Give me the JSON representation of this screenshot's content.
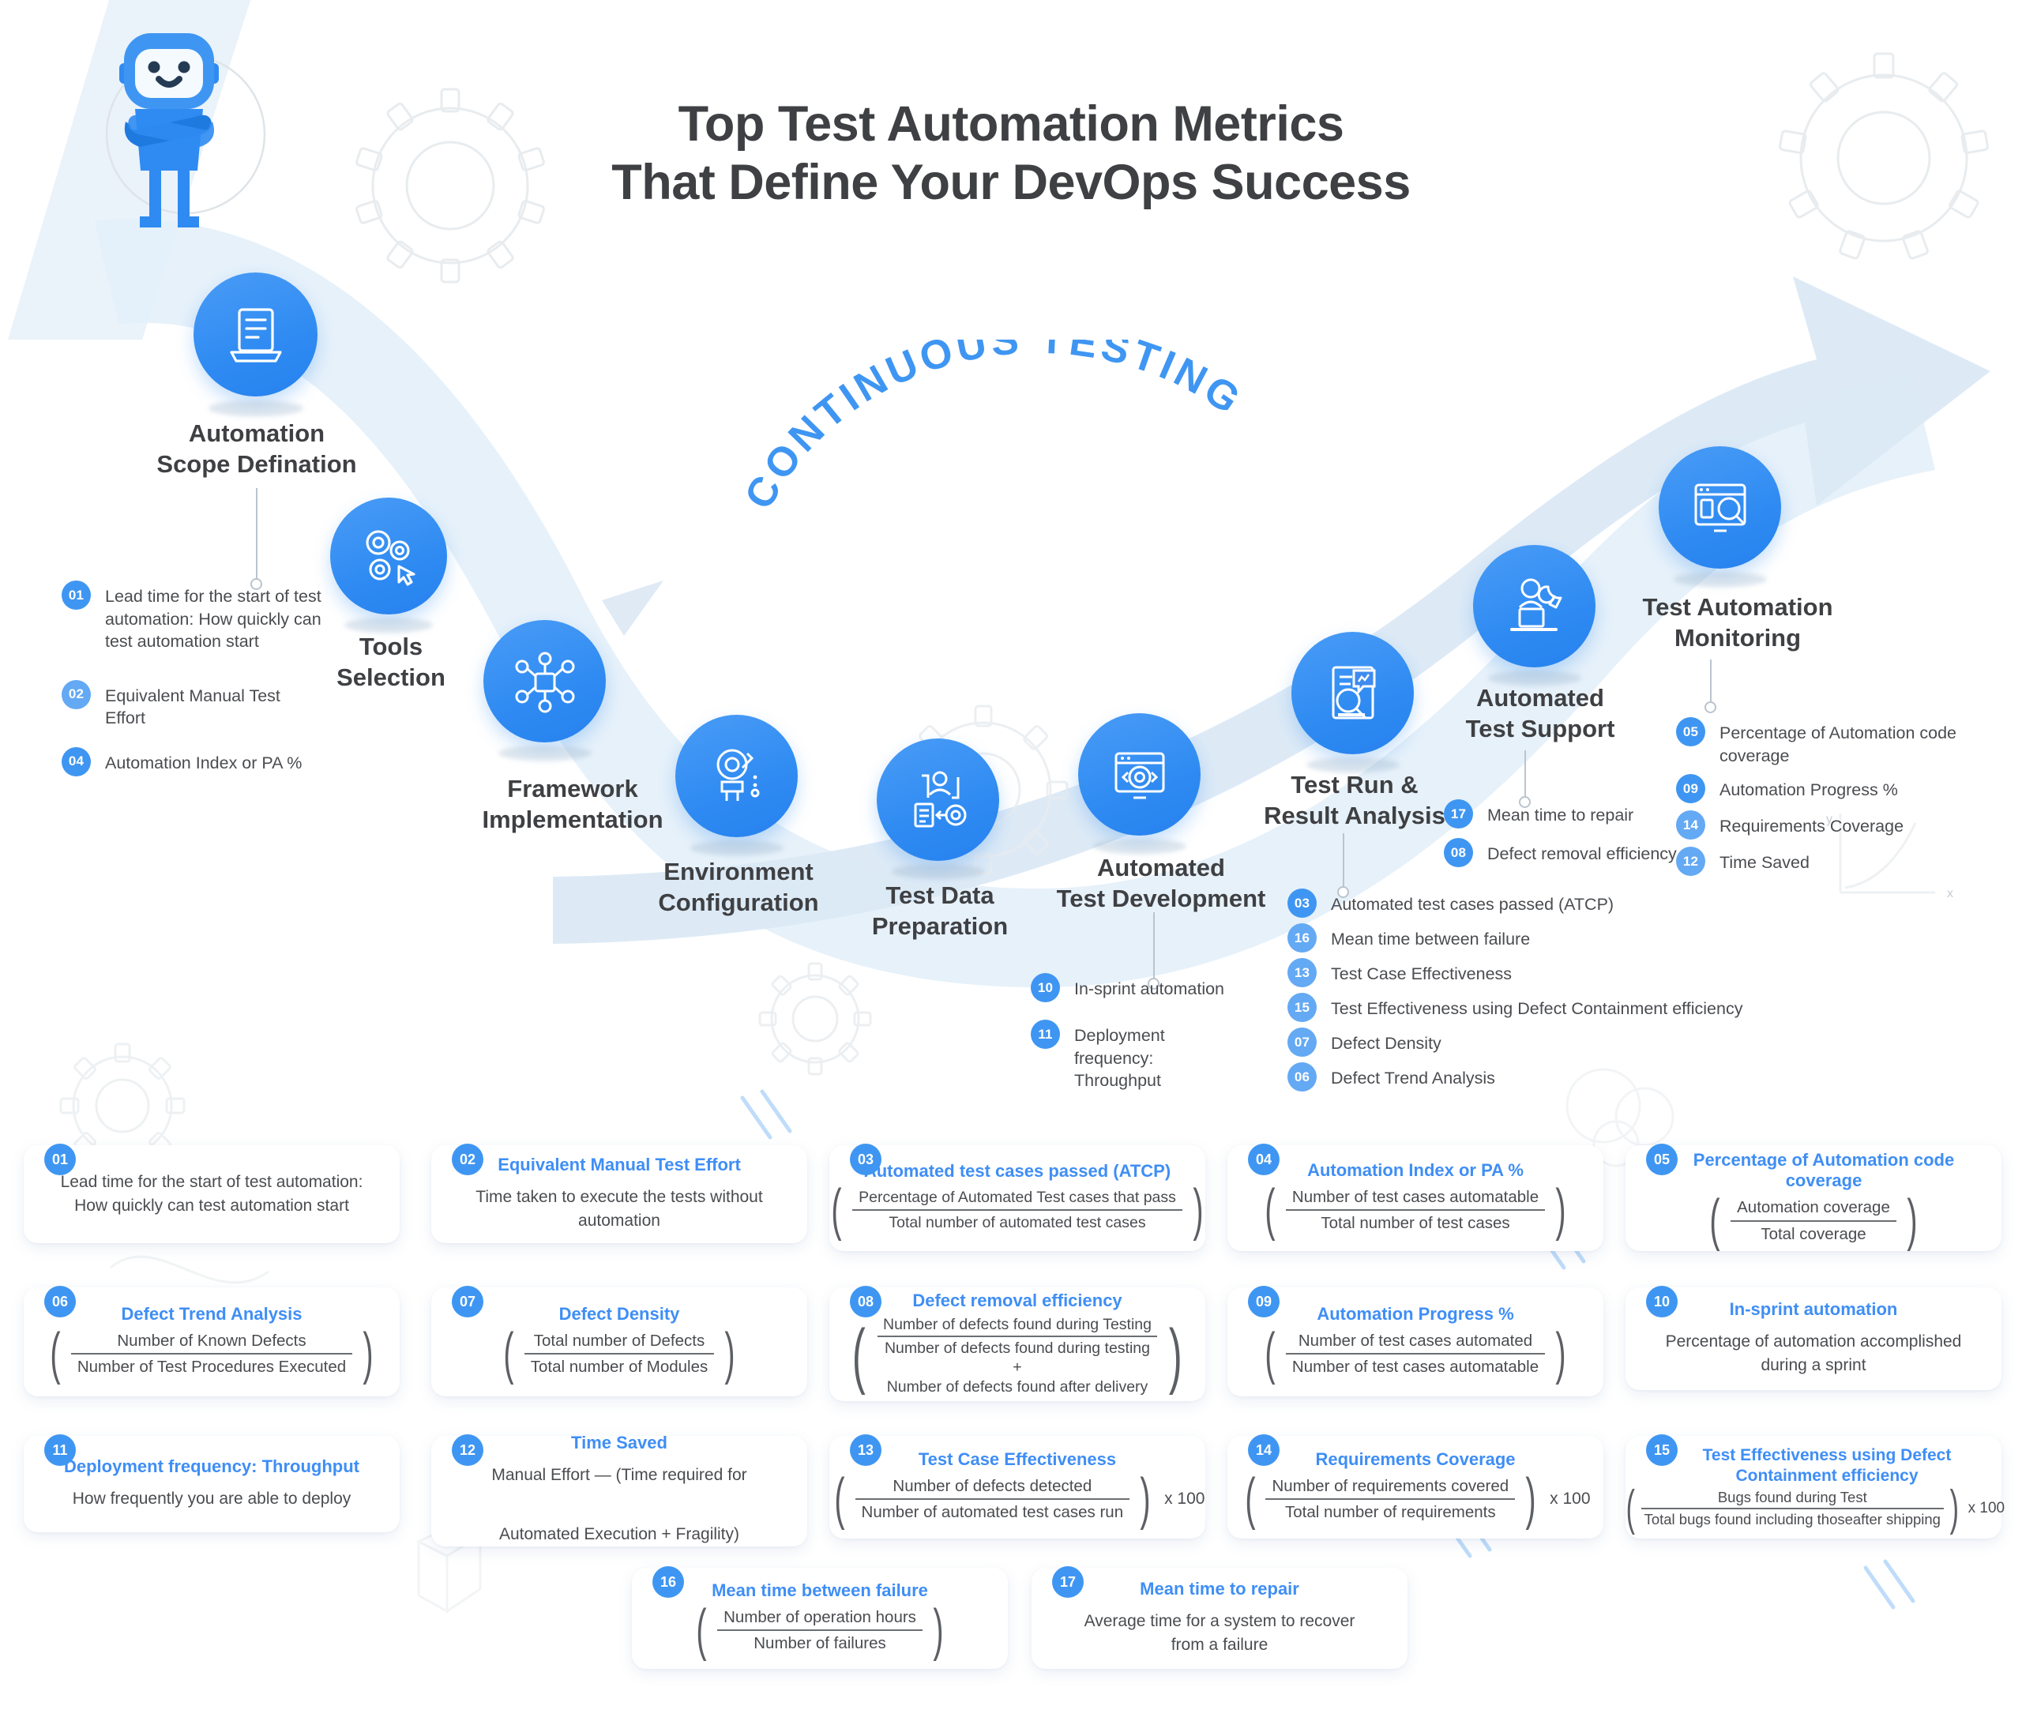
{
  "title": {
    "line1": "Top Test Automation Metrics",
    "line2": "That Define Your DevOps Success"
  },
  "arc_label": "CONTINUOUS TESTING",
  "colors": {
    "accent": "#3f96f2",
    "accent_text": "#3f8ef5",
    "title_text": "#3f4043",
    "body_text": "#4a4c50",
    "background": "#ffffff",
    "ribbon": "#dfecf9"
  },
  "mascot": {
    "name": "robot-mascot"
  },
  "nodes": [
    {
      "id": "automation-scope-defination",
      "label_line1": "Automation",
      "label_line2": "Scope Defination",
      "icon": "document-checklist-icon"
    },
    {
      "id": "tools-selection",
      "label_line1": "Tools",
      "label_line2": "Selection",
      "icon": "gears-cursor-icon"
    },
    {
      "id": "framework-implementation",
      "label_line1": "Framework",
      "label_line2": "Implementation",
      "icon": "network-nodes-icon"
    },
    {
      "id": "environment-configuration",
      "label_line1": "Environment",
      "label_line2": "Configuration",
      "icon": "wrench-gear-icon"
    },
    {
      "id": "test-data-preparation",
      "label_line1": "Test Data",
      "label_line2": "Preparation",
      "icon": "user-data-gear-icon"
    },
    {
      "id": "automated-test-development",
      "label_line1": "Automated",
      "label_line2": "Test Development",
      "icon": "code-gear-browser-icon"
    },
    {
      "id": "test-run-result-analysis",
      "label_line1": "Test Run &",
      "label_line2": "Result Analysis",
      "icon": "report-chart-search-icon"
    },
    {
      "id": "automated-test-support",
      "label_line1": "Automated",
      "label_line2": "Test Support",
      "icon": "support-engineer-icon"
    },
    {
      "id": "test-automation-monitoring",
      "label_line1": "Test Automation",
      "label_line2": "Monitoring",
      "icon": "dashboard-magnifier-icon"
    }
  ],
  "metric_groups": {
    "scope": [
      {
        "num": "01",
        "text": "Lead time for the start of test automation: How quickly can test automation start"
      },
      {
        "num": "02",
        "text": "Equivalent Manual Test Effort"
      },
      {
        "num": "04",
        "text": "Automation Index or PA %"
      }
    ],
    "test_development": [
      {
        "num": "10",
        "text": "In-sprint automation"
      },
      {
        "num": "11",
        "text": "Deployment frequency: Throughput"
      }
    ],
    "test_run": [
      {
        "num": "03",
        "text": "Automated test cases passed (ATCP)"
      },
      {
        "num": "16",
        "text": "Mean time between failure"
      },
      {
        "num": "13",
        "text": "Test Case Effectiveness"
      },
      {
        "num": "15",
        "text": "Test Effectiveness using Defect Containment efficiency"
      },
      {
        "num": "07",
        "text": "Defect Density"
      },
      {
        "num": "06",
        "text": "Defect Trend Analysis"
      }
    ],
    "test_support": [
      {
        "num": "17",
        "text": "Mean time to repair"
      },
      {
        "num": "08",
        "text": "Defect removal efficiency"
      }
    ],
    "monitoring": [
      {
        "num": "05",
        "text": "Percentage of Automation code coverage"
      },
      {
        "num": "09",
        "text": "Automation Progress %"
      },
      {
        "num": "14",
        "text": "Requirements Coverage"
      },
      {
        "num": "12",
        "text": "Time Saved"
      }
    ]
  },
  "cards": [
    {
      "num": "01",
      "title": "",
      "desc": "Lead time for the start of test automation:\nHow quickly can test automation start",
      "type": "desc"
    },
    {
      "num": "02",
      "title": "Equivalent Manual Test Effort",
      "desc": "Time taken to execute the tests without automation",
      "type": "desc"
    },
    {
      "num": "03",
      "title": "Automated test cases passed (ATCP)",
      "numerator": "Percentage of Automated Test cases that pass",
      "denominator": "Total number of automated test cases",
      "multiplier": "",
      "type": "fraction"
    },
    {
      "num": "04",
      "title": "Automation Index or PA %",
      "numerator": "Number of test cases automatable",
      "denominator": "Total number of test cases",
      "multiplier": "",
      "type": "fraction"
    },
    {
      "num": "05",
      "title": "Percentage of Automation code coverage",
      "numerator": "Automation coverage",
      "denominator": "Total coverage",
      "multiplier": "",
      "type": "fraction"
    },
    {
      "num": "06",
      "title": "Defect Trend Analysis",
      "numerator": "Number of Known Defects",
      "denominator": "Number of Test Procedures Executed",
      "multiplier": "",
      "type": "fraction"
    },
    {
      "num": "07",
      "title": "Defect Density",
      "numerator": "Total number of Defects",
      "denominator": "Total number of Modules",
      "multiplier": "",
      "type": "fraction"
    },
    {
      "num": "08",
      "title": "Defect removal efficiency",
      "numerator": "Number of defects found during Testing",
      "denominator": "Number of defects found during testing +\nNumber of defects found after delivery",
      "multiplier": "",
      "type": "fraction"
    },
    {
      "num": "09",
      "title": "Automation Progress %",
      "numerator": "Number of test cases automated",
      "denominator": "Number of test cases automatable",
      "multiplier": "",
      "type": "fraction"
    },
    {
      "num": "10",
      "title": "In-sprint automation",
      "desc": "Percentage of automation accomplished\nduring a sprint",
      "type": "desc"
    },
    {
      "num": "11",
      "title": "Deployment frequency: Throughput",
      "desc": "How frequently you are able to deploy",
      "type": "desc"
    },
    {
      "num": "12",
      "title": "Time Saved",
      "desc": "Manual Effort — (Time required for\n\nAutomated Execution + Fragility)",
      "type": "desc"
    },
    {
      "num": "13",
      "title": "Test Case Effectiveness",
      "numerator": "Number of defects detected",
      "denominator": "Number of automated test cases run",
      "multiplier": "x 100",
      "type": "fraction"
    },
    {
      "num": "14",
      "title": "Requirements Coverage",
      "numerator": "Number of requirements covered",
      "denominator": "Total number of requirements",
      "multiplier": "x 100",
      "type": "fraction"
    },
    {
      "num": "15",
      "title": "Test Effectiveness using Defect\nContainment efficiency",
      "numerator": "Bugs found during Test",
      "denominator": "Total bugs found including thoseafter shipping",
      "multiplier": "x 100",
      "type": "fraction"
    },
    {
      "num": "16",
      "title": "Mean time between failure",
      "numerator": "Number of operation hours",
      "denominator": "Number of failures",
      "multiplier": "",
      "type": "fraction"
    },
    {
      "num": "17",
      "title": "Mean time to repair",
      "desc": "Average time for a system to recover\nfrom a failure",
      "type": "desc"
    }
  ]
}
